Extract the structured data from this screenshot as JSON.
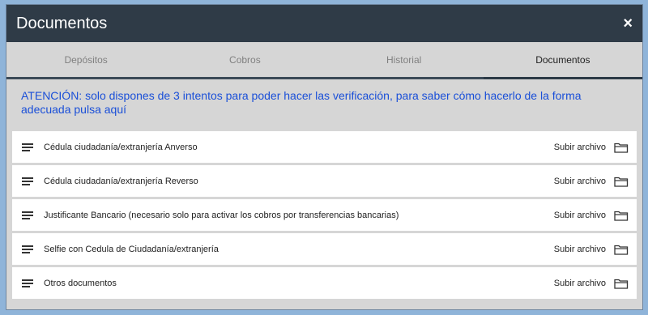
{
  "modal": {
    "title": "Documentos",
    "close_label": "×"
  },
  "tabs": [
    {
      "label": "Depósitos",
      "active": false
    },
    {
      "label": "Cobros",
      "active": false
    },
    {
      "label": "Historial",
      "active": false
    },
    {
      "label": "Documentos",
      "active": true
    }
  ],
  "notice": {
    "text": "ATENCIÓN: solo dispones de 3 intentos para poder hacer las verificación, para saber cómo hacerlo de la forma adecuada pulsa aquí"
  },
  "documents": [
    {
      "label": "Cédula ciudadanía/extranjería Anverso",
      "action": "Subir archivo"
    },
    {
      "label": "Cédula ciudadanía/extranjería Reverso",
      "action": "Subir archivo"
    },
    {
      "label": "Justificante Bancario (necesario solo para activar los cobros por transferencias bancarias)",
      "action": "Subir archivo"
    },
    {
      "label": "Selfie con Cedula de Ciudadanía/extranjería",
      "action": "Subir archivo"
    },
    {
      "label": "Otros documentos",
      "action": "Subir archivo"
    }
  ],
  "colors": {
    "header_bg": "#2f3b47",
    "notice_text": "#1a4fd8",
    "active_tab": "#2c3a46"
  }
}
